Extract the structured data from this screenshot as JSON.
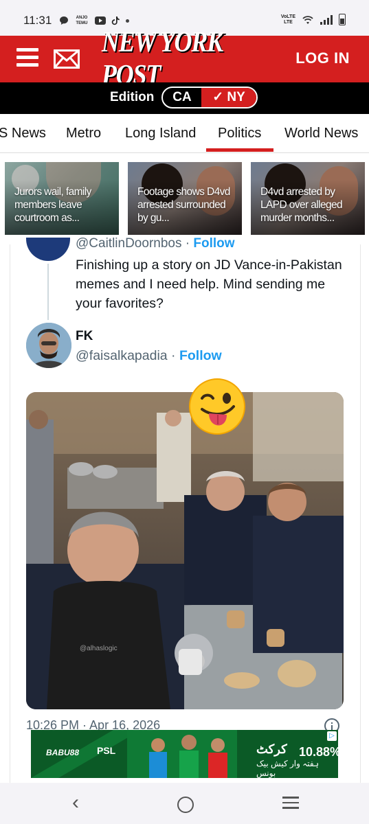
{
  "status_bar": {
    "time": "11:31",
    "carrier_badge": "ANJO TEMU",
    "network": "VoLTE",
    "network_sub": "LTE"
  },
  "header": {
    "logo_text": "NEW YORK POST",
    "login_label": "LOG IN",
    "brand_color": "#d41f1f"
  },
  "edition": {
    "label": "Edition",
    "options": [
      "CA",
      "NY"
    ],
    "selected": "NY",
    "selected_mark": "✓"
  },
  "nav": {
    "items": [
      "S News",
      "Metro",
      "Long Island",
      "Politics",
      "World News"
    ],
    "active": "Politics"
  },
  "stories": [
    {
      "title": "Jurors wail, family members leave courtroom as..."
    },
    {
      "title": "Footage shows D4vd arrested surrounded by gu..."
    },
    {
      "title": "D4vd arrested by LAPD over alleged murder months..."
    }
  ],
  "tweet": {
    "reply_to_handle": "@CaitlinDoornbos",
    "reply_to_follow": "Follow",
    "text": "Finishing up a story on JD Vance-in-Pakistan memes and I need help. Mind sending me your favorites?",
    "author_name": "FK",
    "author_handle": "@faisalkapadia",
    "author_follow": "Follow",
    "separator": "·",
    "image_watermark": "@alhaslogic",
    "timestamp": "10:26 PM · Apr 16, 2026"
  },
  "ad": {
    "brand": "BABU88",
    "league": "PSL",
    "percent": "10.88%",
    "urdu_headline": "کرکٹ",
    "urdu_sub": "ہفتہ وار کیش بیک بونس",
    "adchoices": "▷"
  },
  "system_nav": {
    "back": "‹",
    "home": "home",
    "recents": "recents"
  }
}
